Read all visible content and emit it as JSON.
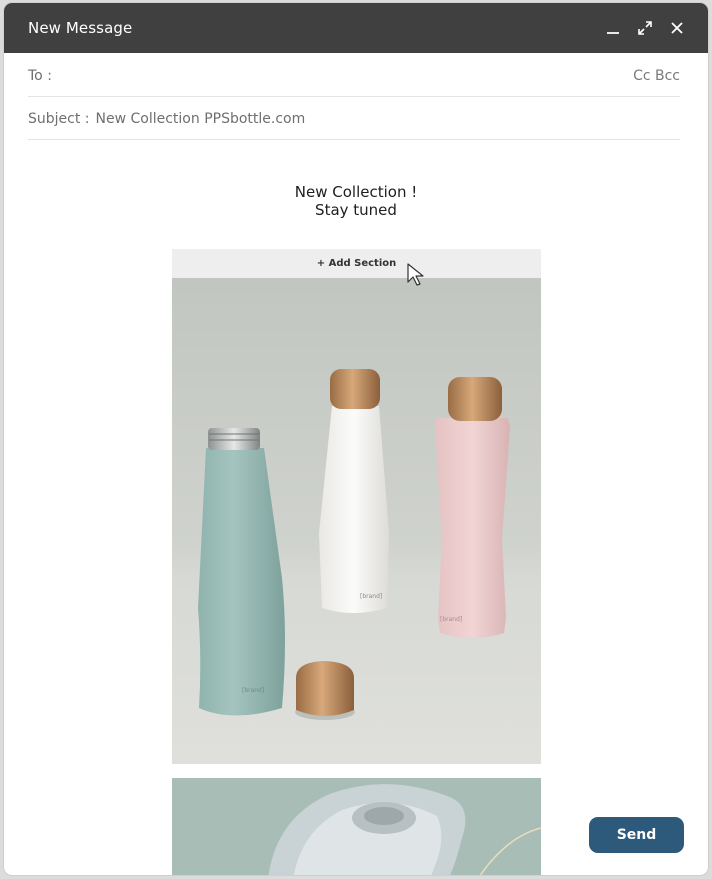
{
  "window": {
    "title": "New Message",
    "titlebar_color": "#404040"
  },
  "compose": {
    "to_label": "To :",
    "to_value": "",
    "cc_bcc": "Cc Bcc",
    "subject_label": "Subject :",
    "subject_value": "New Collection PPSbottle.com"
  },
  "body": {
    "heading_line1": "New Collection  !",
    "heading_line2": "Stay tuned",
    "add_section_label": "+ Add Section",
    "bottle_brand": "[brand]"
  },
  "actions": {
    "send_label": "Send",
    "send_color": "#2d5a7b"
  },
  "icons": [
    "minimize-icon",
    "expand-icon",
    "close-icon",
    "cursor-icon"
  ]
}
